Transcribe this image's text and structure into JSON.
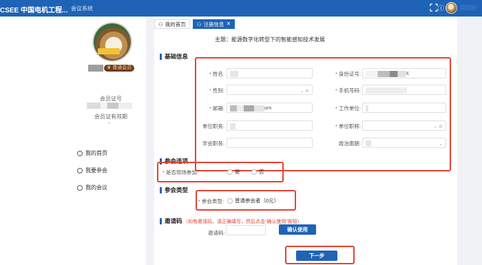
{
  "header": {
    "brand": "CSEE 中国电机工程...",
    "nav_label": "会议系统",
    "icons": [
      "fullscreen-icon",
      "notice-icon",
      "user-avatar"
    ]
  },
  "sidebar": {
    "vip_badge": "普通会员",
    "member_no_label": "会员证号",
    "expiry_label": "会员证有效期",
    "expiry_value": "-",
    "menu": [
      {
        "label": "我的首页"
      },
      {
        "label": "我要参会"
      },
      {
        "label": "我的会议"
      }
    ]
  },
  "tabs": [
    {
      "label": "我的首页",
      "active": false
    },
    {
      "label": "注册信息",
      "active": true
    }
  ],
  "topic": "主题：能源数字化转型下的智能感知技术发展",
  "sections": {
    "basic": "基础信息",
    "options": "参会选项",
    "type": "参会类型",
    "invite": "邀请码"
  },
  "basic_info": {
    "name_label": "姓名:",
    "id_label": "身份证号:",
    "id_value_end": "X",
    "gender_label": "性别:",
    "phone_label": "手机号码:",
    "email_label": "邮箱:",
    "email_value_end": "om",
    "work_unit_label": "工作单位:",
    "unit_position_label": "单位职务:",
    "unit_title_label": "单位职称:",
    "society_position_label": "学会职务:",
    "political_label": "政治面貌:"
  },
  "attend_options": {
    "onsite_label": "是否现场参加:",
    "yes": "是",
    "no": "否"
  },
  "attend_type": {
    "label": "参会类型:",
    "option": "普通参会者（0元）"
  },
  "invite": {
    "hint": "（如有邀请码，请正确填写，然后点击“确认使用”按钮）",
    "label": "邀请码:",
    "confirm_button": "确认使用"
  },
  "next_button": "下一步",
  "colors": {
    "primary": "#1f63b6",
    "highlight": "#e34234"
  }
}
